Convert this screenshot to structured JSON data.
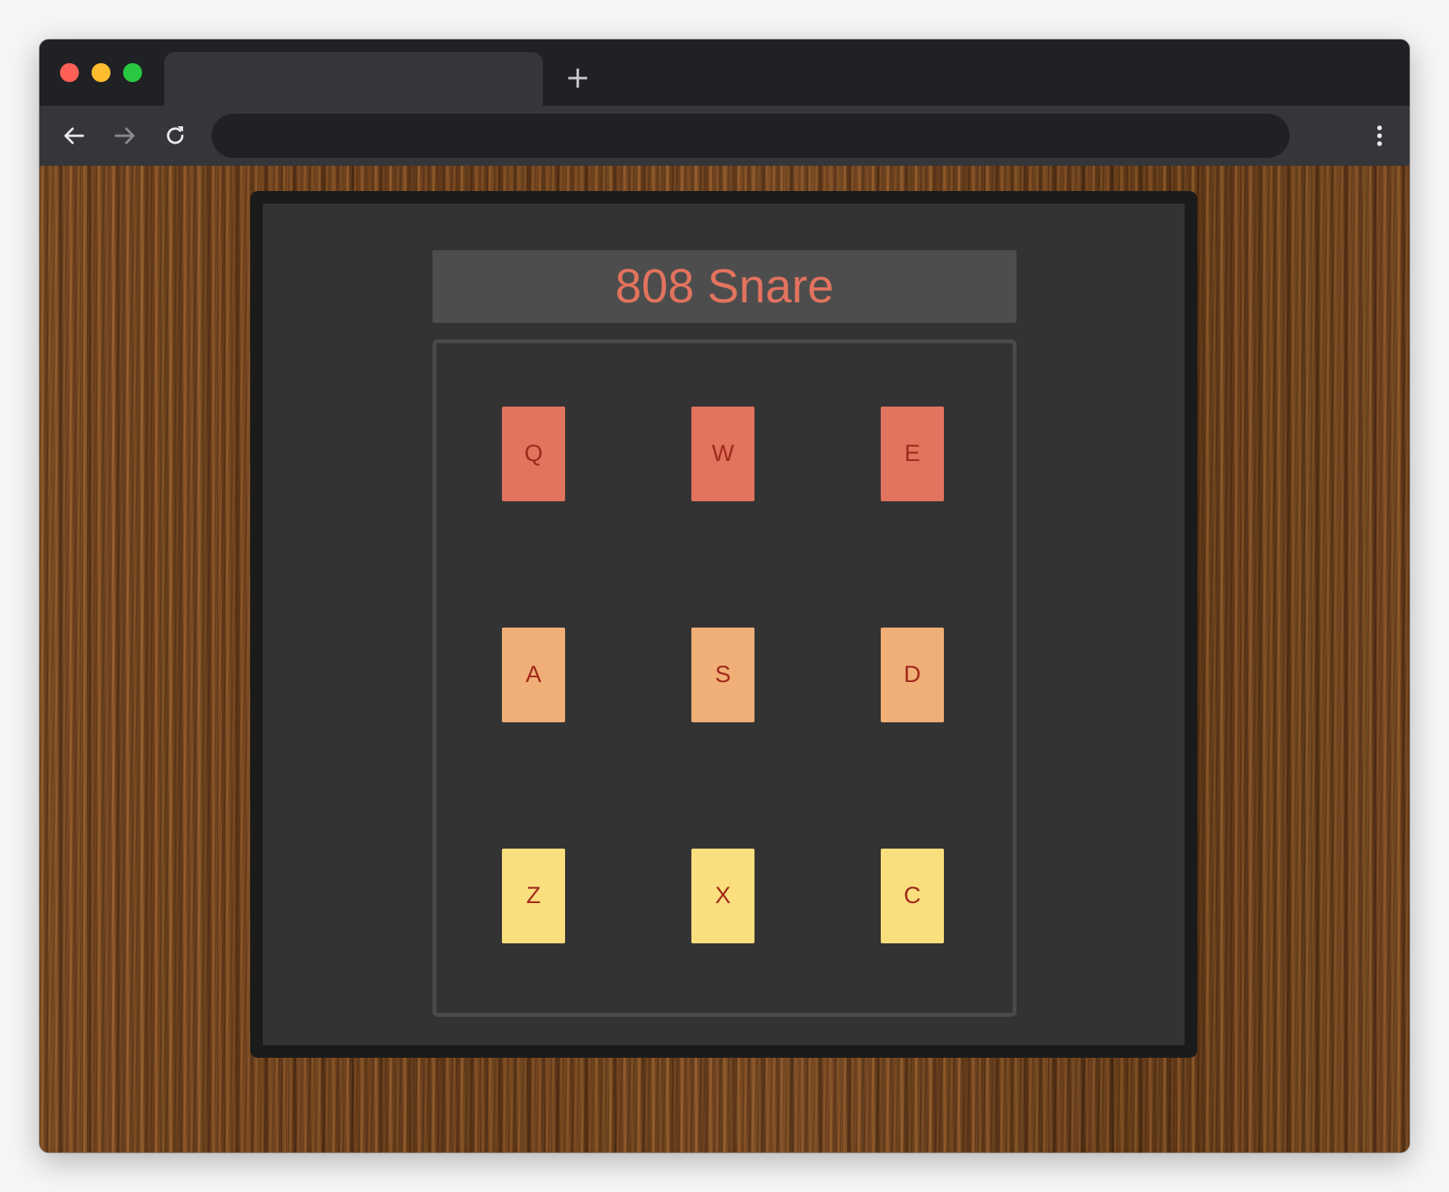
{
  "browser": {
    "new_tab_symbol": "+",
    "address": ""
  },
  "drum_machine": {
    "display_text": "808 Snare",
    "colors": {
      "row1": "#e2735e",
      "row2": "#f1af78",
      "row3": "#fbde7e",
      "key_text": "#a02a1c",
      "display_text": "#e2735e"
    },
    "pads": [
      {
        "key": "Q"
      },
      {
        "key": "W"
      },
      {
        "key": "E"
      },
      {
        "key": "A"
      },
      {
        "key": "S"
      },
      {
        "key": "D"
      },
      {
        "key": "Z"
      },
      {
        "key": "X"
      },
      {
        "key": "C"
      }
    ]
  }
}
